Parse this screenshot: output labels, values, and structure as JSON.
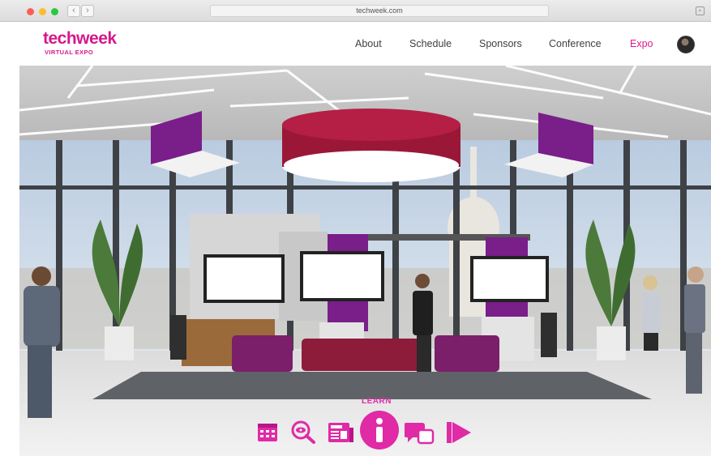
{
  "browser": {
    "url": "techweek.com",
    "back_glyph": "‹",
    "forward_glyph": "›"
  },
  "site": {
    "logo_text": "techweek",
    "logo_sub": "VIRTUAL EXPO",
    "brand_color": "#d6178c"
  },
  "nav": {
    "items": [
      "About",
      "Schedule",
      "Sponsors",
      "Conference",
      "Expo"
    ],
    "active": "Expo"
  },
  "toolbar": {
    "active_label": "LEARN",
    "accent_color": "#e02aa6",
    "icons": [
      "calendar-icon",
      "search-eye-icon",
      "news-icon",
      "info-icon",
      "chat-icon",
      "play-icon"
    ]
  }
}
